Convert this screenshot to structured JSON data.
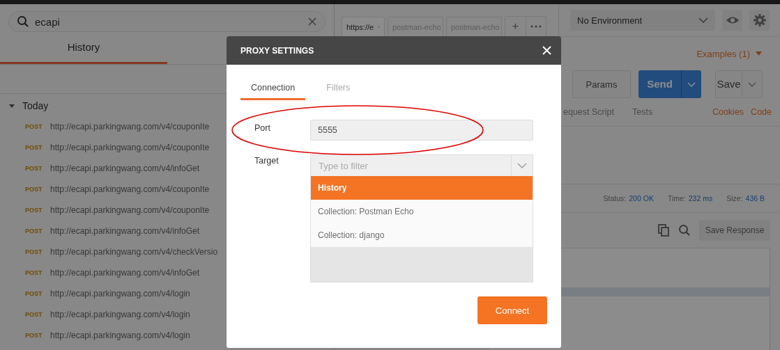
{
  "sidebar": {
    "search": {
      "value": "ecapi"
    },
    "tabs": [
      {
        "label": "History",
        "selected": true
      }
    ],
    "groups": [
      {
        "label": "Today",
        "expanded": true,
        "items": [
          {
            "method": "POST",
            "url": "http://ecapi.parkingwang.com/v4/couponIte"
          },
          {
            "method": "POST",
            "url": "http://ecapi.parkingwang.com/v4/couponIte"
          },
          {
            "method": "POST",
            "url": "http://ecapi.parkingwang.com/v4/infoGet"
          },
          {
            "method": "POST",
            "url": "http://ecapi.parkingwang.com/v4/couponIte"
          },
          {
            "method": "POST",
            "url": "http://ecapi.parkingwang.com/v4/couponIte"
          },
          {
            "method": "POST",
            "url": "http://ecapi.parkingwang.com/v4/infoGet"
          },
          {
            "method": "POST",
            "url": "http://ecapi.parkingwang.com/v4/checkVersio"
          },
          {
            "method": "POST",
            "url": "http://ecapi.parkingwang.com/v4/infoGet"
          },
          {
            "method": "POST",
            "url": "http://ecapi.parkingwang.com/v4/login"
          },
          {
            "method": "POST",
            "url": "http://ecapi.parkingwang.com/v4/login"
          },
          {
            "method": "POST",
            "url": "http://ecapi.parkingwang.com/v4/login"
          }
        ]
      }
    ]
  },
  "request_tabs": [
    {
      "label": "https://e",
      "selected": true
    },
    {
      "label": "postman-echo",
      "selected": false
    },
    {
      "label": "postman-echo",
      "selected": false
    }
  ],
  "new_tab": "+",
  "environment": {
    "value": "No Environment"
  },
  "examples": "Examples (1)",
  "params_button": "Params",
  "send_button": "Send",
  "save_button": "Save",
  "section_tabs": [
    {
      "label": "equest Script"
    },
    {
      "label": "Tests"
    }
  ],
  "links": [
    "Cookies",
    "Code"
  ],
  "response": {
    "stats": [
      {
        "label": "Status:",
        "value": "200 OK"
      },
      {
        "label": "Time:",
        "value": "232 ms"
      },
      {
        "label": "Size:",
        "value": "436 B"
      }
    ],
    "save_response": "Save Response"
  },
  "dialog": {
    "title": "PROXY SETTINGS",
    "tabs": [
      {
        "label": "Connection",
        "selected": true
      },
      {
        "label": "Filters",
        "selected": false
      }
    ],
    "port": {
      "label": "Port",
      "value": "5555"
    },
    "target": {
      "label": "Target",
      "placeholder": "Type to filter",
      "options": [
        {
          "label": "History",
          "selected": true
        },
        {
          "label": "Collection: Postman Echo",
          "selected": false
        },
        {
          "label": "Collection: django",
          "selected": false
        }
      ]
    },
    "button": "Connect"
  }
}
